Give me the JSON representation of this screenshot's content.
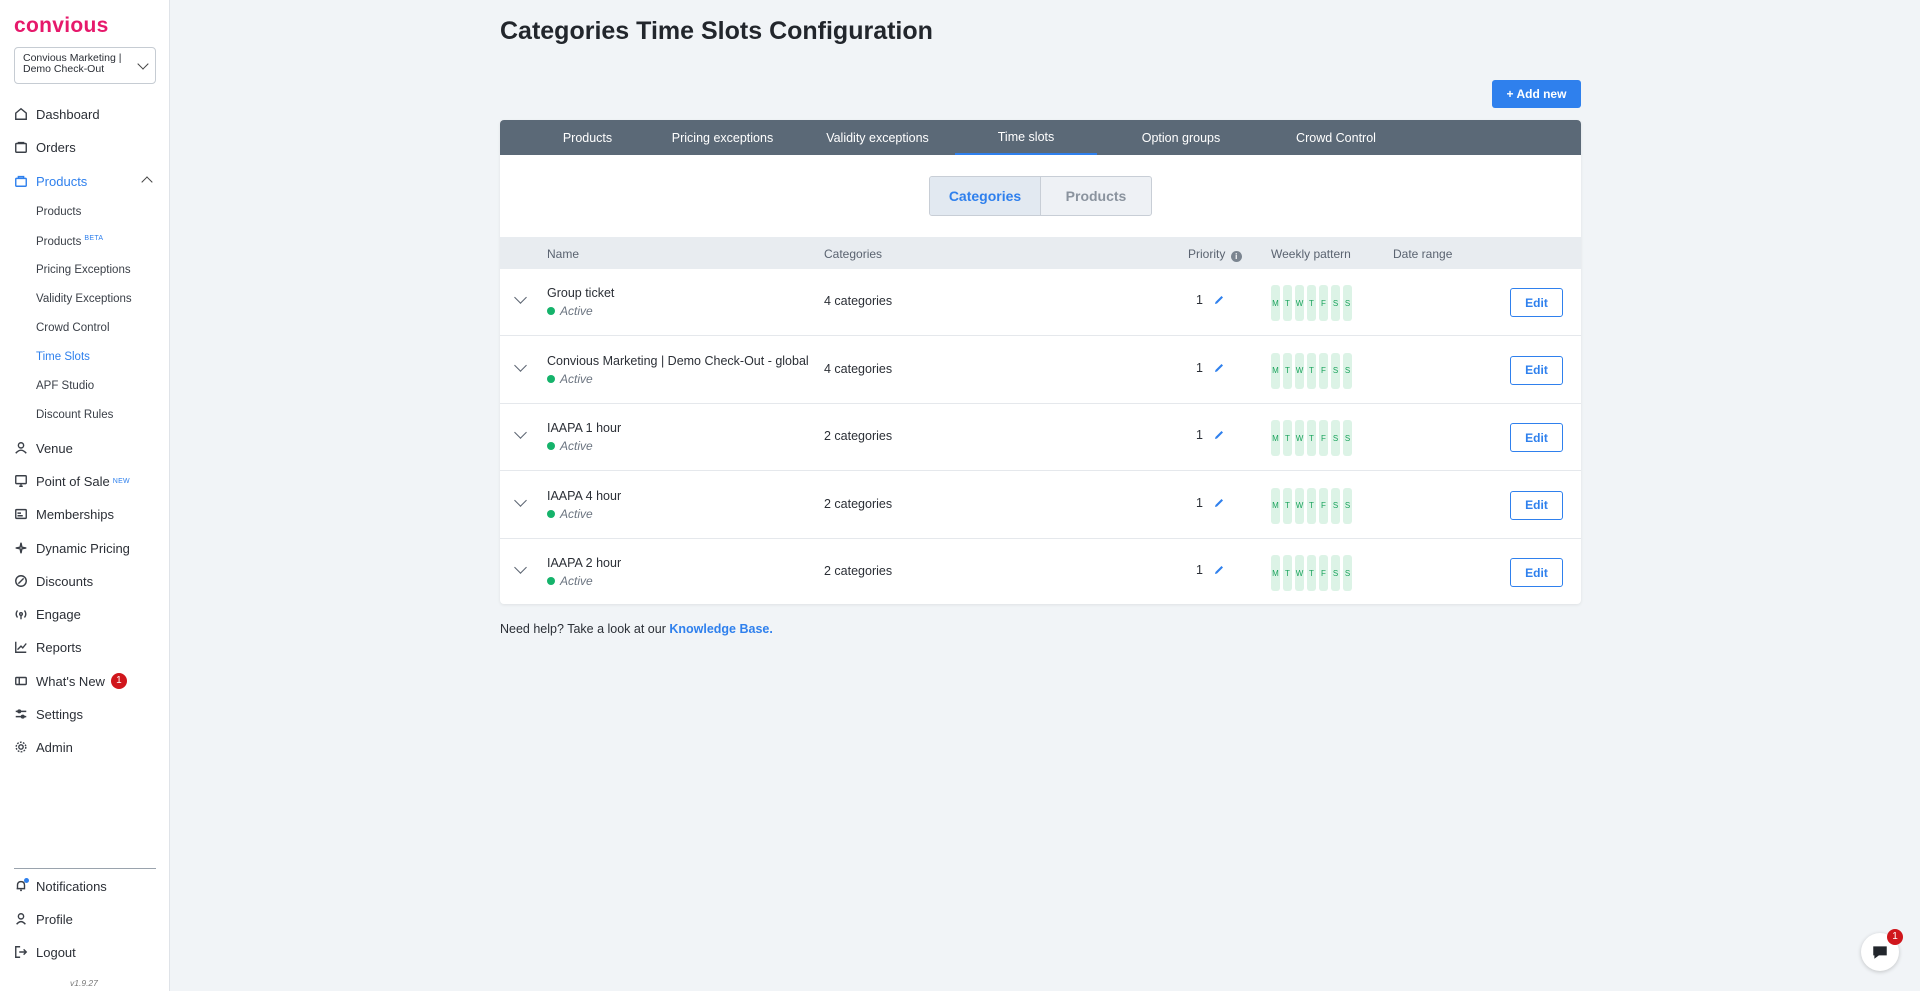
{
  "brand": {
    "logo": "convious",
    "accent": "#2f80ed",
    "logo_color": "#e6196b"
  },
  "account": {
    "name": "Convious Marketing | Demo Check-Out"
  },
  "sidebar": {
    "items": [
      {
        "label": "Dashboard",
        "icon": "home-icon"
      },
      {
        "label": "Orders",
        "icon": "bag-icon"
      },
      {
        "label": "Products",
        "icon": "box-icon",
        "active": true
      },
      {
        "label": "Venue",
        "icon": "person-icon"
      },
      {
        "label": "Point of Sale",
        "icon": "monitor-icon",
        "tag": "NEW"
      },
      {
        "label": "Memberships",
        "icon": "card-icon"
      },
      {
        "label": "Dynamic Pricing",
        "icon": "sparkle-icon"
      },
      {
        "label": "Discounts",
        "icon": "percent-icon"
      },
      {
        "label": "Engage",
        "icon": "broadcast-icon"
      },
      {
        "label": "Reports",
        "icon": "chart-icon"
      },
      {
        "label": "What's New",
        "icon": "ticket-icon",
        "badge": "1"
      },
      {
        "label": "Settings",
        "icon": "sliders-icon"
      },
      {
        "label": "Admin",
        "icon": "gear-icon"
      }
    ],
    "sub_items": [
      {
        "label": "Products"
      },
      {
        "label": "Products",
        "tag": "BETA"
      },
      {
        "label": "Pricing Exceptions"
      },
      {
        "label": "Validity Exceptions"
      },
      {
        "label": "Crowd Control"
      },
      {
        "label": "Time Slots",
        "active": true
      },
      {
        "label": "APF Studio"
      },
      {
        "label": "Discount Rules"
      }
    ],
    "bottom": [
      {
        "label": "Notifications",
        "icon": "bell-icon"
      },
      {
        "label": "Profile",
        "icon": "profile-icon"
      },
      {
        "label": "Logout",
        "icon": "logout-icon"
      }
    ],
    "version": "v1.9.27"
  },
  "page": {
    "title": "Categories Time Slots Configuration",
    "add_label": "+ Add new"
  },
  "tabs": [
    {
      "label": "Products"
    },
    {
      "label": "Pricing exceptions"
    },
    {
      "label": "Validity exceptions"
    },
    {
      "label": "Time slots",
      "active": true
    },
    {
      "label": "Option groups"
    },
    {
      "label": "Crowd Control"
    }
  ],
  "toggle": {
    "left": "Categories",
    "right": "Products",
    "selected": "Categories"
  },
  "table": {
    "headers": {
      "name": "Name",
      "categories": "Categories",
      "priority": "Priority",
      "weekly": "Weekly pattern",
      "date_range": "Date range"
    },
    "days": [
      "M",
      "T",
      "W",
      "T",
      "F",
      "S",
      "S"
    ],
    "rows": [
      {
        "name": "Group ticket",
        "status": "Active",
        "categories": "4 categories",
        "priority": "1",
        "edit": "Edit"
      },
      {
        "name": "Convious Marketing | Demo Check-Out - global",
        "status": "Active",
        "categories": "4 categories",
        "priority": "1",
        "edit": "Edit"
      },
      {
        "name": "IAAPA 1 hour",
        "status": "Active",
        "categories": "2 categories",
        "priority": "1",
        "edit": "Edit"
      },
      {
        "name": "IAAPA 4 hour",
        "status": "Active",
        "categories": "2 categories",
        "priority": "1",
        "edit": "Edit"
      },
      {
        "name": "IAAPA 2 hour",
        "status": "Active",
        "categories": "2 categories",
        "priority": "1",
        "edit": "Edit"
      }
    ]
  },
  "help": {
    "prefix": "Need help? Take a look at our ",
    "link": "Knowledge Base."
  },
  "chat": {
    "badge": "1"
  }
}
